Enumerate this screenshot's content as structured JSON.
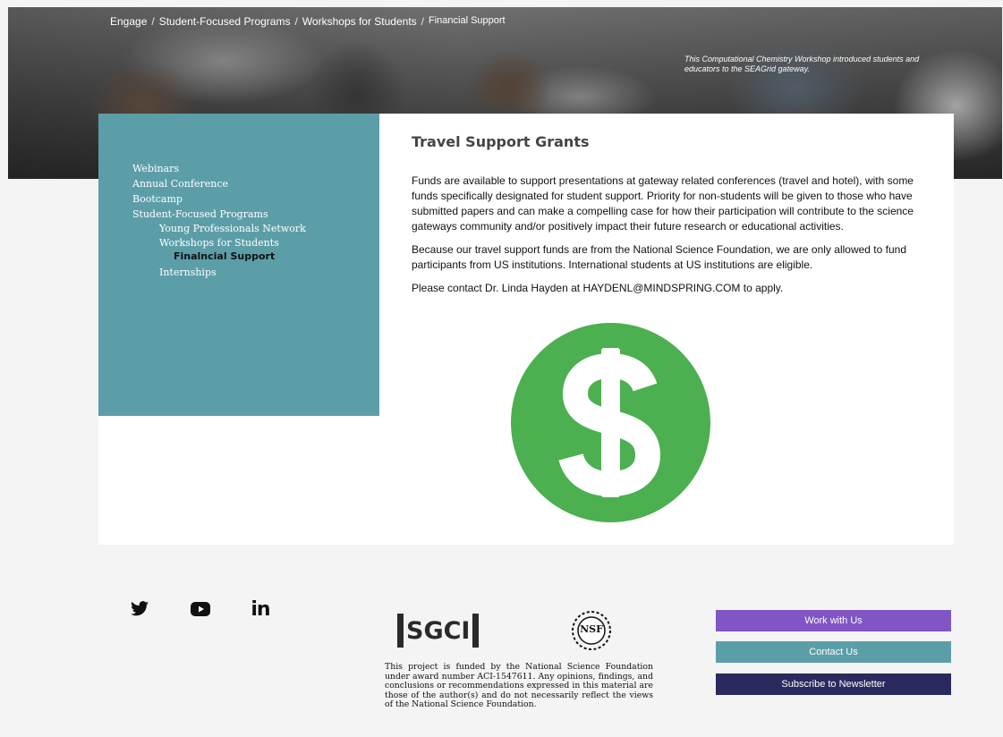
{
  "breadcrumb": {
    "items": [
      "Engage",
      "Student-Focused Programs",
      "Workshops for Students"
    ],
    "current": "Financial Support",
    "separator": "/"
  },
  "hero": {
    "caption": "This Computational Chemistry Workshop introduced students and educators to the SEAGrid gateway."
  },
  "sidebar": {
    "items": [
      {
        "label": "Webinars"
      },
      {
        "label": "Annual Conference"
      },
      {
        "label": "Bootcamp"
      },
      {
        "label": "Student-Focused Programs"
      },
      {
        "label": "Young Professionals Network"
      },
      {
        "label": "Workshops for Students"
      },
      {
        "label": "Finalncial Support"
      },
      {
        "label": "Internships"
      }
    ]
  },
  "main": {
    "title": "Travel Support Grants",
    "paragraphs": [
      "Funds are available to support presentations at gateway related conferences (travel and hotel), with some funds specifically designated for student support. Priority for non-students will be given to those who have submitted papers and can make a compelling case for how their participation will contribute to the science gateways community and/or positively impact their future research or educational activities.",
      "Because our travel support funds are from the National Science Foundation, we are only allowed to fund participants from US institutions. International students at US institutions are eligible.",
      "Please contact Dr. Linda Hayden at HAYDENL@MINDSPRING.COM to apply."
    ],
    "dollar_icon": "dollar-sign-icon"
  },
  "footer": {
    "social": [
      "twitter-icon",
      "youtube-icon",
      "linkedin-icon"
    ],
    "linkedin_text": "in",
    "sgci_logo_text": "SGCI",
    "nsf_logo_text": "NSF",
    "funding_text": "This project is funded by the National Science Foundation under award number ACI-1547611. Any opinions, findings, and conclusions or recommendations expressed in this material are those of the author(s) and do not necessarily reflect the views of the National Science Foundation.",
    "buttons": [
      {
        "label": "Work with Us",
        "color": "#8155c6"
      },
      {
        "label": "Contact Us",
        "color": "#5c9ea8"
      },
      {
        "label": "Subscribe to Newsletter",
        "color": "#2b2a5e"
      }
    ]
  },
  "colors": {
    "sidebar": "#5c9ea8",
    "dollar_green": "#4caf50",
    "page_bg": "#f4f4f4"
  }
}
